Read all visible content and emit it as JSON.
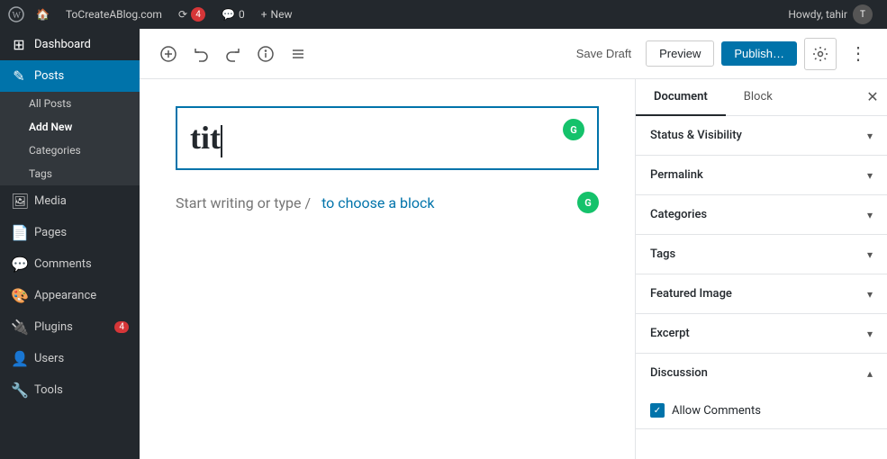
{
  "adminBar": {
    "logo": "W",
    "site_name": "ToCreateABlog.com",
    "updates_count": "4",
    "comments_label": "0",
    "new_label": "New",
    "howdy": "Howdy, tahir"
  },
  "sidebar": {
    "items": [
      {
        "id": "dashboard",
        "label": "Dashboard",
        "icon": "⊞"
      },
      {
        "id": "posts",
        "label": "Posts",
        "icon": "✎",
        "active": true
      },
      {
        "id": "all-posts",
        "label": "All Posts",
        "sub": true
      },
      {
        "id": "add-new",
        "label": "Add New",
        "sub": true,
        "active_sub": true
      },
      {
        "id": "categories",
        "label": "Categories",
        "sub": true
      },
      {
        "id": "tags",
        "label": "Tags",
        "sub": true
      },
      {
        "id": "media",
        "label": "Media",
        "icon": "⊟"
      },
      {
        "id": "pages",
        "label": "Pages",
        "icon": "📄"
      },
      {
        "id": "comments",
        "label": "Comments",
        "icon": "💬"
      },
      {
        "id": "appearance",
        "label": "Appearance",
        "icon": "🎨"
      },
      {
        "id": "plugins",
        "label": "Plugins",
        "icon": "🔌",
        "badge": "4"
      },
      {
        "id": "users",
        "label": "Users",
        "icon": "👤"
      },
      {
        "id": "tools",
        "label": "Tools",
        "icon": "🔧"
      }
    ]
  },
  "toolbar": {
    "add_block_title": "Add block",
    "undo_title": "Undo",
    "redo_title": "Redo",
    "info_title": "View info",
    "list_view_title": "List view",
    "save_draft_label": "Save Draft",
    "preview_label": "Preview",
    "publish_label": "Publish…",
    "settings_title": "Settings",
    "more_title": "More tools & options"
  },
  "editor": {
    "title_text": "tit",
    "placeholder_text": "Start writing or type / to choose a block",
    "placeholder_link": "to choose a block"
  },
  "rightPanel": {
    "tabs": [
      {
        "id": "document",
        "label": "Document",
        "active": true
      },
      {
        "id": "block",
        "label": "Block"
      }
    ],
    "sections": [
      {
        "id": "status-visibility",
        "label": "Status & Visibility",
        "expanded": false
      },
      {
        "id": "permalink",
        "label": "Permalink",
        "expanded": false
      },
      {
        "id": "categories",
        "label": "Categories",
        "expanded": false
      },
      {
        "id": "tags",
        "label": "Tags",
        "expanded": false
      },
      {
        "id": "featured-image",
        "label": "Featured Image",
        "expanded": false
      },
      {
        "id": "excerpt",
        "label": "Excerpt",
        "expanded": false
      },
      {
        "id": "discussion",
        "label": "Discussion",
        "expanded": true
      }
    ],
    "discussion": {
      "allow_comments_label": "Allow Comments",
      "checked": true
    }
  }
}
